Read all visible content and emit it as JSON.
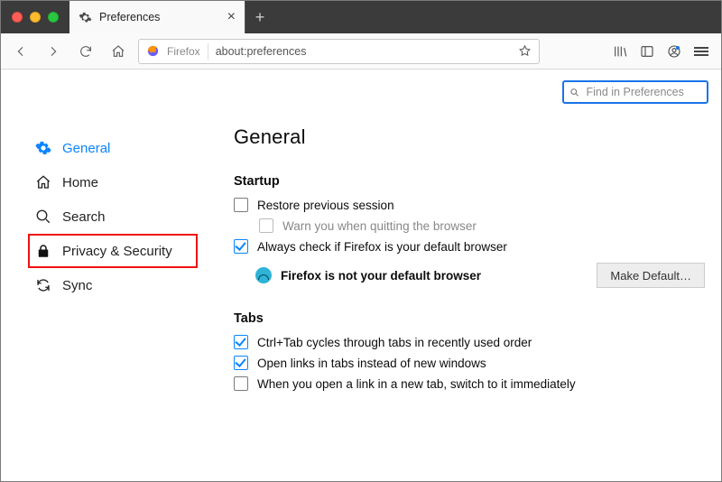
{
  "titlebar": {
    "tab_label": "Preferences",
    "app_name": "Firefox"
  },
  "urlbar": {
    "identity": "Firefox",
    "address": "about:preferences"
  },
  "pref_search": {
    "placeholder": "Find in Preferences"
  },
  "sidebar": {
    "items": [
      {
        "label": "General"
      },
      {
        "label": "Home"
      },
      {
        "label": "Search"
      },
      {
        "label": "Privacy & Security"
      },
      {
        "label": "Sync"
      }
    ]
  },
  "main": {
    "heading": "General",
    "startup": {
      "title": "Startup",
      "restore_session": "Restore previous session",
      "warn_on_quit": "Warn you when quitting the browser",
      "always_check_default": "Always check if Firefox is your default browser",
      "status": "Firefox is not your default browser",
      "make_default_btn": "Make Default…"
    },
    "tabs": {
      "title": "Tabs",
      "ctrl_tab": "Ctrl+Tab cycles through tabs in recently used order",
      "open_in_tabs": "Open links in tabs instead of new windows",
      "switch_immediately": "When you open a link in a new tab, switch to it immediately"
    }
  }
}
